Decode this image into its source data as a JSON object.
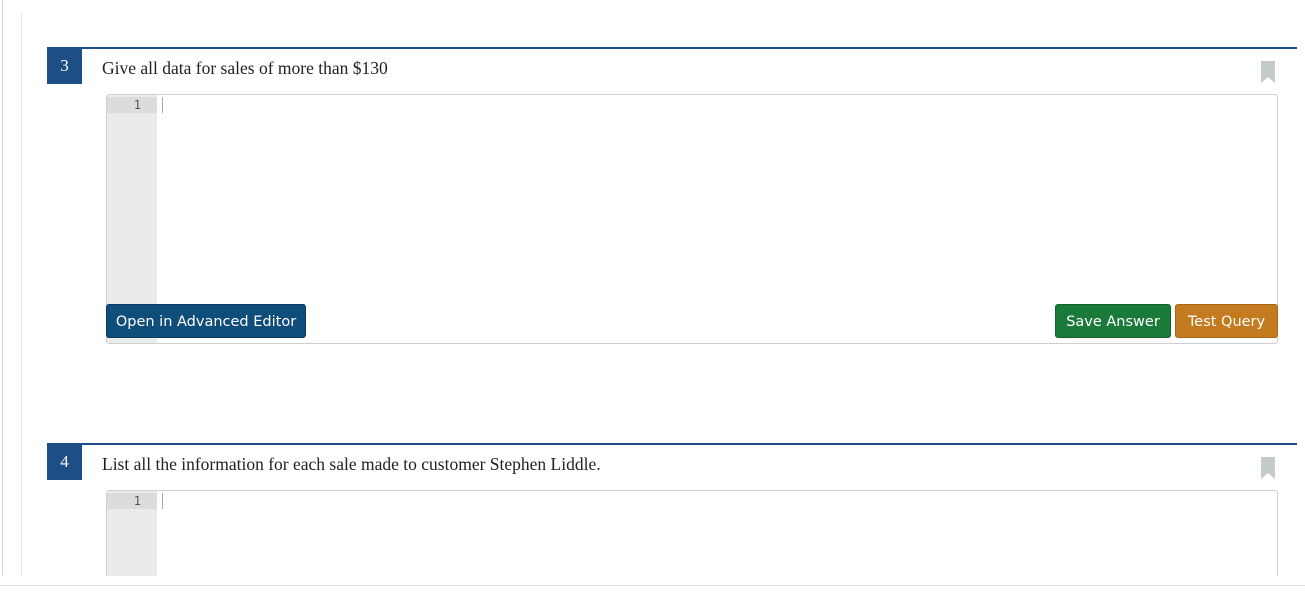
{
  "questions": [
    {
      "number": "3",
      "prompt": "Give all data for sales of more than $130",
      "editor": {
        "line_numbers": [
          "1"
        ],
        "content": ""
      },
      "buttons": {
        "advanced_editor": "Open in Advanced Editor",
        "save": "Save Answer",
        "test": "Test Query"
      }
    },
    {
      "number": "4",
      "prompt": "List all the information for each sale made to customer Stephen Liddle.",
      "editor": {
        "line_numbers": [
          "1"
        ],
        "content": ""
      }
    }
  ],
  "icons": {
    "bookmark": "bookmark-icon"
  },
  "colors": {
    "accent": "#1d4f86",
    "advanced_button": "#0f4d7b",
    "save_button": "#1a7a3a",
    "test_button": "#c47a1f",
    "bookmark": "#c3cbc6"
  }
}
